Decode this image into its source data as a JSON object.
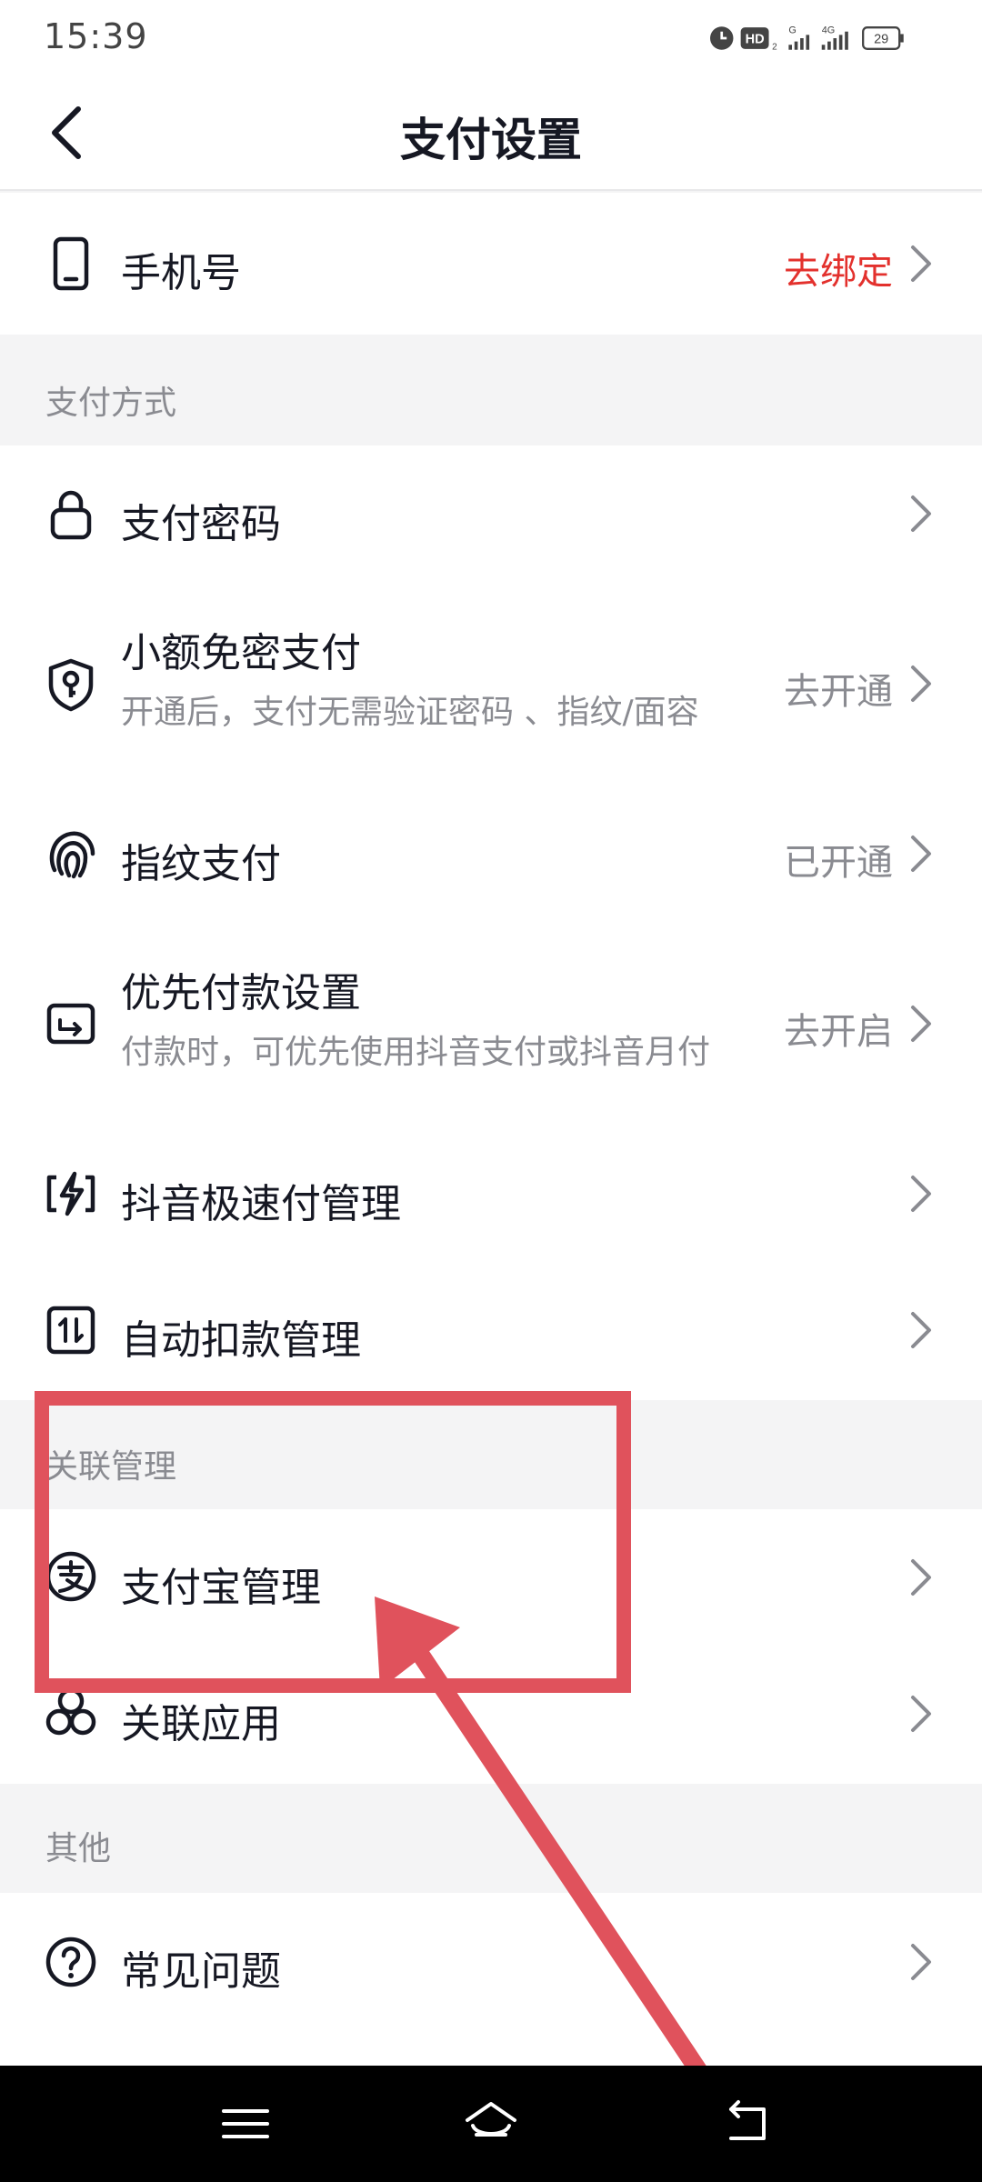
{
  "status_bar": {
    "time": "15:39",
    "battery": "29",
    "signal_1": "G",
    "signal_2": "4G",
    "hd": "HD"
  },
  "header": {
    "title": "支付设置",
    "back_icon": "back-arrow-icon"
  },
  "phone_row": {
    "label": "手机号",
    "status": "去绑定",
    "status_color": "#e3312d",
    "icon": "phone-icon"
  },
  "sections": {
    "payment_methods": "支付方式",
    "linked_management": "关联管理",
    "other": "其他"
  },
  "payment_items": [
    {
      "label": "支付密码",
      "subtitle": "",
      "status": "",
      "icon": "lock-icon"
    },
    {
      "label": "小额免密支付",
      "subtitle": "开通后，支付无需验证密码 、指纹/面容",
      "status": "去开通",
      "icon": "shield-key-icon"
    },
    {
      "label": "指纹支付",
      "subtitle": "",
      "status": "已开通",
      "icon": "fingerprint-icon"
    },
    {
      "label": "优先付款设置",
      "subtitle": "付款时，可优先使用抖音支付或抖音月付",
      "status": "去开启",
      "icon": "priority-card-icon"
    },
    {
      "label": "抖音极速付管理",
      "subtitle": "",
      "status": "",
      "icon": "lightning-card-icon"
    },
    {
      "label": "自动扣款管理",
      "subtitle": "",
      "status": "",
      "icon": "auto-deduct-icon"
    }
  ],
  "linked_items": [
    {
      "label": "支付宝管理",
      "icon": "alipay-icon"
    },
    {
      "label": "关联应用",
      "icon": "linked-apps-icon"
    }
  ],
  "other_items": [
    {
      "label": "常见问题",
      "icon": "question-icon"
    }
  ],
  "nav": {
    "menu_icon": "menu-icon",
    "home_icon": "home-icon",
    "back_icon": "return-icon"
  },
  "colors": {
    "accent_red": "#e3312d",
    "annotation": "#e0525c",
    "text_primary": "#161823",
    "text_secondary": "#8a8b91",
    "background": "#f4f4f5"
  }
}
